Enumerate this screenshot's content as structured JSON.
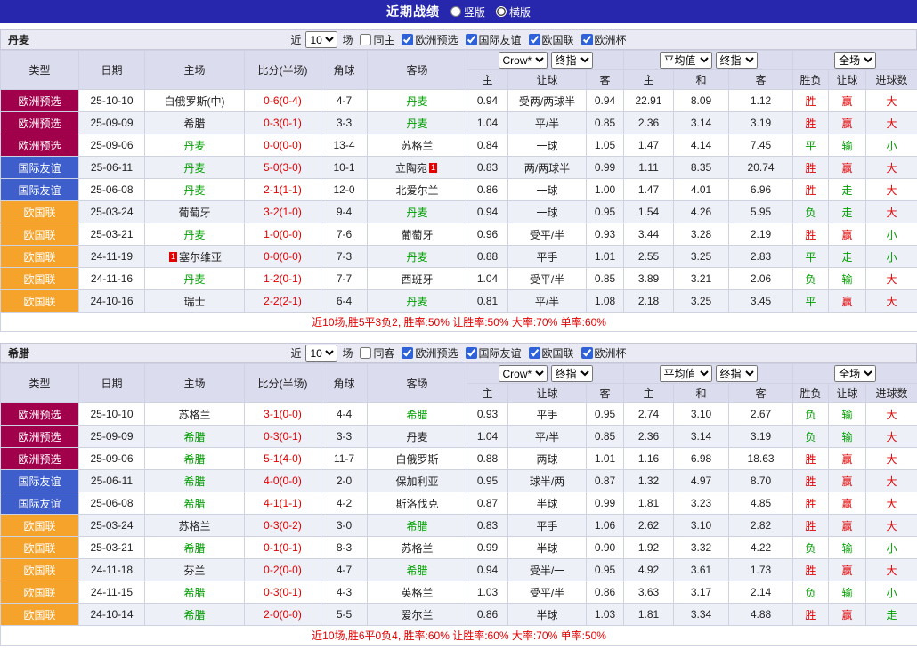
{
  "topbar": {
    "title": "近期战绩",
    "options": [
      {
        "label": "竖版",
        "selected": false
      },
      {
        "label": "横版",
        "selected": true
      }
    ]
  },
  "colors": {
    "topbar_bg": "#2727ad",
    "comp_euro_qualifier": "#a1004b",
    "comp_friendly": "#3d5ecb",
    "comp_nations_league": "#f6a32b",
    "positive_red": "#e30000",
    "negative_green": "#00a000",
    "header_bg": "#dbdcee",
    "row_alt_bg": "#eef0f8"
  },
  "columns": {
    "type": "类型",
    "date": "日期",
    "home": "主场",
    "score": "比分(半场)",
    "corners": "角球",
    "away": "客场",
    "odds1_selects": [
      "Crow*",
      "终指"
    ],
    "odds1_cols": [
      "主",
      "让球",
      "客"
    ],
    "odds2_selects": [
      "平均值",
      "终指"
    ],
    "odds2_cols": [
      "主",
      "和",
      "客"
    ],
    "result_select": "全场",
    "result_cols": [
      "胜负",
      "让球",
      "进球数"
    ]
  },
  "sections": [
    {
      "team": "丹麦",
      "filter": {
        "prefix": "近",
        "count": "10",
        "suffix": "场",
        "checkboxes": [
          {
            "label": "同主",
            "checked": false
          },
          {
            "label": "欧洲预选",
            "checked": true
          },
          {
            "label": "国际友谊",
            "checked": true
          },
          {
            "label": "欧国联",
            "checked": true
          },
          {
            "label": "欧洲杯",
            "checked": true
          }
        ]
      },
      "rows": [
        {
          "comp": "欧洲预选",
          "cc": "c1",
          "date": "25-10-10",
          "home": "白俄罗斯(中)",
          "hc": "",
          "score": "0-6(0-4)",
          "corner": "4-7",
          "away": "丹麦",
          "ac": "g",
          "o1": [
            "0.94",
            "受两/两球半",
            "0.94"
          ],
          "o2": [
            "22.91",
            "8.09",
            "1.12"
          ],
          "res": [
            "胜",
            "赢",
            "大"
          ],
          "rc": [
            "r",
            "r",
            "r"
          ]
        },
        {
          "comp": "欧洲预选",
          "cc": "c1",
          "date": "25-09-09",
          "home": "希腊",
          "hc": "",
          "score": "0-3(0-1)",
          "corner": "3-3",
          "away": "丹麦",
          "ac": "g",
          "o1": [
            "1.04",
            "平/半",
            "0.85"
          ],
          "o2": [
            "2.36",
            "3.14",
            "3.19"
          ],
          "res": [
            "胜",
            "赢",
            "大"
          ],
          "rc": [
            "r",
            "r",
            "r"
          ]
        },
        {
          "comp": "欧洲预选",
          "cc": "c1",
          "date": "25-09-06",
          "home": "丹麦",
          "hc": "g",
          "score": "0-0(0-0)",
          "corner": "13-4",
          "away": "苏格兰",
          "ac": "",
          "o1": [
            "0.84",
            "一球",
            "1.05"
          ],
          "o2": [
            "1.47",
            "4.14",
            "7.45"
          ],
          "res": [
            "平",
            "输",
            "小"
          ],
          "rc": [
            "g",
            "g",
            "g"
          ]
        },
        {
          "comp": "国际友谊",
          "cc": "c2",
          "date": "25-06-11",
          "home": "丹麦",
          "hc": "g",
          "score": "5-0(3-0)",
          "corner": "10-1",
          "away": "立陶宛",
          "ac": "",
          "ab": "1",
          "o1": [
            "0.83",
            "两/两球半",
            "0.99"
          ],
          "o2": [
            "1.11",
            "8.35",
            "20.74"
          ],
          "res": [
            "胜",
            "赢",
            "大"
          ],
          "rc": [
            "r",
            "r",
            "r"
          ]
        },
        {
          "comp": "国际友谊",
          "cc": "c2",
          "date": "25-06-08",
          "home": "丹麦",
          "hc": "g",
          "score": "2-1(1-1)",
          "corner": "12-0",
          "away": "北爱尔兰",
          "ac": "",
          "o1": [
            "0.86",
            "一球",
            "1.00"
          ],
          "o2": [
            "1.47",
            "4.01",
            "6.96"
          ],
          "res": [
            "胜",
            "走",
            "大"
          ],
          "rc": [
            "r",
            "g",
            "r"
          ]
        },
        {
          "comp": "欧国联",
          "cc": "c3",
          "date": "25-03-24",
          "home": "葡萄牙",
          "hc": "",
          "score": "3-2(1-0)",
          "corner": "9-4",
          "away": "丹麦",
          "ac": "g",
          "o1": [
            "0.94",
            "一球",
            "0.95"
          ],
          "o2": [
            "1.54",
            "4.26",
            "5.95"
          ],
          "res": [
            "负",
            "走",
            "大"
          ],
          "rc": [
            "g",
            "g",
            "r"
          ]
        },
        {
          "comp": "欧国联",
          "cc": "c3",
          "date": "25-03-21",
          "home": "丹麦",
          "hc": "g",
          "score": "1-0(0-0)",
          "corner": "7-6",
          "away": "葡萄牙",
          "ac": "",
          "o1": [
            "0.96",
            "受平/半",
            "0.93"
          ],
          "o2": [
            "3.44",
            "3.28",
            "2.19"
          ],
          "res": [
            "胜",
            "赢",
            "小"
          ],
          "rc": [
            "r",
            "r",
            "g"
          ]
        },
        {
          "comp": "欧国联",
          "cc": "c3",
          "date": "24-11-19",
          "home": "塞尔维亚",
          "hc": "",
          "hbp": "1",
          "score": "0-0(0-0)",
          "corner": "7-3",
          "away": "丹麦",
          "ac": "g",
          "o1": [
            "0.88",
            "平手",
            "1.01"
          ],
          "o2": [
            "2.55",
            "3.25",
            "2.83"
          ],
          "res": [
            "平",
            "走",
            "小"
          ],
          "rc": [
            "g",
            "g",
            "g"
          ]
        },
        {
          "comp": "欧国联",
          "cc": "c3",
          "date": "24-11-16",
          "home": "丹麦",
          "hc": "g",
          "score": "1-2(0-1)",
          "corner": "7-7",
          "away": "西班牙",
          "ac": "",
          "o1": [
            "1.04",
            "受平/半",
            "0.85"
          ],
          "o2": [
            "3.89",
            "3.21",
            "2.06"
          ],
          "res": [
            "负",
            "输",
            "大"
          ],
          "rc": [
            "g",
            "g",
            "r"
          ]
        },
        {
          "comp": "欧国联",
          "cc": "c3",
          "date": "24-10-16",
          "home": "瑞士",
          "hc": "",
          "score": "2-2(2-1)",
          "corner": "6-4",
          "away": "丹麦",
          "ac": "g",
          "o1": [
            "0.81",
            "平/半",
            "1.08"
          ],
          "o2": [
            "2.18",
            "3.25",
            "3.45"
          ],
          "res": [
            "平",
            "赢",
            "大"
          ],
          "rc": [
            "g",
            "r",
            "r"
          ]
        }
      ],
      "summary": "近10场,胜5平3负2, 胜率:50% 让胜率:50% 大率:70% 单率:60%"
    },
    {
      "team": "希腊",
      "filter": {
        "prefix": "近",
        "count": "10",
        "suffix": "场",
        "checkboxes": [
          {
            "label": "同客",
            "checked": false
          },
          {
            "label": "欧洲预选",
            "checked": true
          },
          {
            "label": "国际友谊",
            "checked": true
          },
          {
            "label": "欧国联",
            "checked": true
          },
          {
            "label": "欧洲杯",
            "checked": true
          }
        ]
      },
      "rows": [
        {
          "comp": "欧洲预选",
          "cc": "c1",
          "date": "25-10-10",
          "home": "苏格兰",
          "hc": "",
          "score": "3-1(0-0)",
          "corner": "4-4",
          "away": "希腊",
          "ac": "g",
          "o1": [
            "0.93",
            "平手",
            "0.95"
          ],
          "o2": [
            "2.74",
            "3.10",
            "2.67"
          ],
          "res": [
            "负",
            "输",
            "大"
          ],
          "rc": [
            "g",
            "g",
            "r"
          ]
        },
        {
          "comp": "欧洲预选",
          "cc": "c1",
          "date": "25-09-09",
          "home": "希腊",
          "hc": "g",
          "score": "0-3(0-1)",
          "corner": "3-3",
          "away": "丹麦",
          "ac": "",
          "o1": [
            "1.04",
            "平/半",
            "0.85"
          ],
          "o2": [
            "2.36",
            "3.14",
            "3.19"
          ],
          "res": [
            "负",
            "输",
            "大"
          ],
          "rc": [
            "g",
            "g",
            "r"
          ]
        },
        {
          "comp": "欧洲预选",
          "cc": "c1",
          "date": "25-09-06",
          "home": "希腊",
          "hc": "g",
          "score": "5-1(4-0)",
          "corner": "11-7",
          "away": "白俄罗斯",
          "ac": "",
          "o1": [
            "0.88",
            "两球",
            "1.01"
          ],
          "o2": [
            "1.16",
            "6.98",
            "18.63"
          ],
          "res": [
            "胜",
            "赢",
            "大"
          ],
          "rc": [
            "r",
            "r",
            "r"
          ]
        },
        {
          "comp": "国际友谊",
          "cc": "c2",
          "date": "25-06-11",
          "home": "希腊",
          "hc": "g",
          "score": "4-0(0-0)",
          "corner": "2-0",
          "away": "保加利亚",
          "ac": "",
          "o1": [
            "0.95",
            "球半/两",
            "0.87"
          ],
          "o2": [
            "1.32",
            "4.97",
            "8.70"
          ],
          "res": [
            "胜",
            "赢",
            "大"
          ],
          "rc": [
            "r",
            "r",
            "r"
          ]
        },
        {
          "comp": "国际友谊",
          "cc": "c2",
          "date": "25-06-08",
          "home": "希腊",
          "hc": "g",
          "score": "4-1(1-1)",
          "corner": "4-2",
          "away": "斯洛伐克",
          "ac": "",
          "o1": [
            "0.87",
            "半球",
            "0.99"
          ],
          "o2": [
            "1.81",
            "3.23",
            "4.85"
          ],
          "res": [
            "胜",
            "赢",
            "大"
          ],
          "rc": [
            "r",
            "r",
            "r"
          ]
        },
        {
          "comp": "欧国联",
          "cc": "c3",
          "date": "25-03-24",
          "home": "苏格兰",
          "hc": "",
          "score": "0-3(0-2)",
          "corner": "3-0",
          "away": "希腊",
          "ac": "g",
          "o1": [
            "0.83",
            "平手",
            "1.06"
          ],
          "o2": [
            "2.62",
            "3.10",
            "2.82"
          ],
          "res": [
            "胜",
            "赢",
            "大"
          ],
          "rc": [
            "r",
            "r",
            "r"
          ]
        },
        {
          "comp": "欧国联",
          "cc": "c3",
          "date": "25-03-21",
          "home": "希腊",
          "hc": "g",
          "score": "0-1(0-1)",
          "corner": "8-3",
          "away": "苏格兰",
          "ac": "",
          "o1": [
            "0.99",
            "半球",
            "0.90"
          ],
          "o2": [
            "1.92",
            "3.32",
            "4.22"
          ],
          "res": [
            "负",
            "输",
            "小"
          ],
          "rc": [
            "g",
            "g",
            "g"
          ]
        },
        {
          "comp": "欧国联",
          "cc": "c3",
          "date": "24-11-18",
          "home": "芬兰",
          "hc": "",
          "score": "0-2(0-0)",
          "corner": "4-7",
          "away": "希腊",
          "ac": "g",
          "o1": [
            "0.94",
            "受半/一",
            "0.95"
          ],
          "o2": [
            "4.92",
            "3.61",
            "1.73"
          ],
          "res": [
            "胜",
            "赢",
            "大"
          ],
          "rc": [
            "r",
            "r",
            "r"
          ]
        },
        {
          "comp": "欧国联",
          "cc": "c3",
          "date": "24-11-15",
          "home": "希腊",
          "hc": "g",
          "score": "0-3(0-1)",
          "corner": "4-3",
          "away": "英格兰",
          "ac": "",
          "o1": [
            "1.03",
            "受平/半",
            "0.86"
          ],
          "o2": [
            "3.63",
            "3.17",
            "2.14"
          ],
          "res": [
            "负",
            "输",
            "小"
          ],
          "rc": [
            "g",
            "g",
            "g"
          ]
        },
        {
          "comp": "欧国联",
          "cc": "c3",
          "date": "24-10-14",
          "home": "希腊",
          "hc": "g",
          "score": "2-0(0-0)",
          "corner": "5-5",
          "away": "爱尔兰",
          "ac": "",
          "o1": [
            "0.86",
            "半球",
            "1.03"
          ],
          "o2": [
            "1.81",
            "3.34",
            "4.88"
          ],
          "res": [
            "胜",
            "赢",
            "走"
          ],
          "rc": [
            "r",
            "r",
            "g"
          ]
        }
      ],
      "summary": "近10场,胜6平0负4, 胜率:60% 让胜率:60% 大率:70% 单率:50%"
    }
  ]
}
